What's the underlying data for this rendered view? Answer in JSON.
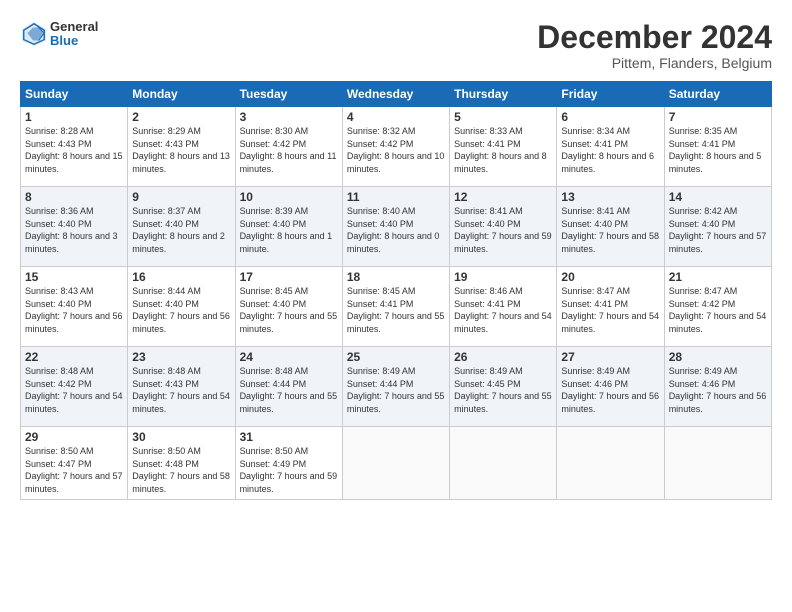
{
  "logo": {
    "general": "General",
    "blue": "Blue"
  },
  "header": {
    "title": "December 2024",
    "subtitle": "Pittem, Flanders, Belgium"
  },
  "days_of_week": [
    "Sunday",
    "Monday",
    "Tuesday",
    "Wednesday",
    "Thursday",
    "Friday",
    "Saturday"
  ],
  "weeks": [
    [
      {
        "day": "1",
        "sunrise": "Sunrise: 8:28 AM",
        "sunset": "Sunset: 4:43 PM",
        "daylight": "Daylight: 8 hours and 15 minutes."
      },
      {
        "day": "2",
        "sunrise": "Sunrise: 8:29 AM",
        "sunset": "Sunset: 4:43 PM",
        "daylight": "Daylight: 8 hours and 13 minutes."
      },
      {
        "day": "3",
        "sunrise": "Sunrise: 8:30 AM",
        "sunset": "Sunset: 4:42 PM",
        "daylight": "Daylight: 8 hours and 11 minutes."
      },
      {
        "day": "4",
        "sunrise": "Sunrise: 8:32 AM",
        "sunset": "Sunset: 4:42 PM",
        "daylight": "Daylight: 8 hours and 10 minutes."
      },
      {
        "day": "5",
        "sunrise": "Sunrise: 8:33 AM",
        "sunset": "Sunset: 4:41 PM",
        "daylight": "Daylight: 8 hours and 8 minutes."
      },
      {
        "day": "6",
        "sunrise": "Sunrise: 8:34 AM",
        "sunset": "Sunset: 4:41 PM",
        "daylight": "Daylight: 8 hours and 6 minutes."
      },
      {
        "day": "7",
        "sunrise": "Sunrise: 8:35 AM",
        "sunset": "Sunset: 4:41 PM",
        "daylight": "Daylight: 8 hours and 5 minutes."
      }
    ],
    [
      {
        "day": "8",
        "sunrise": "Sunrise: 8:36 AM",
        "sunset": "Sunset: 4:40 PM",
        "daylight": "Daylight: 8 hours and 3 minutes."
      },
      {
        "day": "9",
        "sunrise": "Sunrise: 8:37 AM",
        "sunset": "Sunset: 4:40 PM",
        "daylight": "Daylight: 8 hours and 2 minutes."
      },
      {
        "day": "10",
        "sunrise": "Sunrise: 8:39 AM",
        "sunset": "Sunset: 4:40 PM",
        "daylight": "Daylight: 8 hours and 1 minute."
      },
      {
        "day": "11",
        "sunrise": "Sunrise: 8:40 AM",
        "sunset": "Sunset: 4:40 PM",
        "daylight": "Daylight: 8 hours and 0 minutes."
      },
      {
        "day": "12",
        "sunrise": "Sunrise: 8:41 AM",
        "sunset": "Sunset: 4:40 PM",
        "daylight": "Daylight: 7 hours and 59 minutes."
      },
      {
        "day": "13",
        "sunrise": "Sunrise: 8:41 AM",
        "sunset": "Sunset: 4:40 PM",
        "daylight": "Daylight: 7 hours and 58 minutes."
      },
      {
        "day": "14",
        "sunrise": "Sunrise: 8:42 AM",
        "sunset": "Sunset: 4:40 PM",
        "daylight": "Daylight: 7 hours and 57 minutes."
      }
    ],
    [
      {
        "day": "15",
        "sunrise": "Sunrise: 8:43 AM",
        "sunset": "Sunset: 4:40 PM",
        "daylight": "Daylight: 7 hours and 56 minutes."
      },
      {
        "day": "16",
        "sunrise": "Sunrise: 8:44 AM",
        "sunset": "Sunset: 4:40 PM",
        "daylight": "Daylight: 7 hours and 56 minutes."
      },
      {
        "day": "17",
        "sunrise": "Sunrise: 8:45 AM",
        "sunset": "Sunset: 4:40 PM",
        "daylight": "Daylight: 7 hours and 55 minutes."
      },
      {
        "day": "18",
        "sunrise": "Sunrise: 8:45 AM",
        "sunset": "Sunset: 4:41 PM",
        "daylight": "Daylight: 7 hours and 55 minutes."
      },
      {
        "day": "19",
        "sunrise": "Sunrise: 8:46 AM",
        "sunset": "Sunset: 4:41 PM",
        "daylight": "Daylight: 7 hours and 54 minutes."
      },
      {
        "day": "20",
        "sunrise": "Sunrise: 8:47 AM",
        "sunset": "Sunset: 4:41 PM",
        "daylight": "Daylight: 7 hours and 54 minutes."
      },
      {
        "day": "21",
        "sunrise": "Sunrise: 8:47 AM",
        "sunset": "Sunset: 4:42 PM",
        "daylight": "Daylight: 7 hours and 54 minutes."
      }
    ],
    [
      {
        "day": "22",
        "sunrise": "Sunrise: 8:48 AM",
        "sunset": "Sunset: 4:42 PM",
        "daylight": "Daylight: 7 hours and 54 minutes."
      },
      {
        "day": "23",
        "sunrise": "Sunrise: 8:48 AM",
        "sunset": "Sunset: 4:43 PM",
        "daylight": "Daylight: 7 hours and 54 minutes."
      },
      {
        "day": "24",
        "sunrise": "Sunrise: 8:48 AM",
        "sunset": "Sunset: 4:44 PM",
        "daylight": "Daylight: 7 hours and 55 minutes."
      },
      {
        "day": "25",
        "sunrise": "Sunrise: 8:49 AM",
        "sunset": "Sunset: 4:44 PM",
        "daylight": "Daylight: 7 hours and 55 minutes."
      },
      {
        "day": "26",
        "sunrise": "Sunrise: 8:49 AM",
        "sunset": "Sunset: 4:45 PM",
        "daylight": "Daylight: 7 hours and 55 minutes."
      },
      {
        "day": "27",
        "sunrise": "Sunrise: 8:49 AM",
        "sunset": "Sunset: 4:46 PM",
        "daylight": "Daylight: 7 hours and 56 minutes."
      },
      {
        "day": "28",
        "sunrise": "Sunrise: 8:49 AM",
        "sunset": "Sunset: 4:46 PM",
        "daylight": "Daylight: 7 hours and 56 minutes."
      }
    ],
    [
      {
        "day": "29",
        "sunrise": "Sunrise: 8:50 AM",
        "sunset": "Sunset: 4:47 PM",
        "daylight": "Daylight: 7 hours and 57 minutes."
      },
      {
        "day": "30",
        "sunrise": "Sunrise: 8:50 AM",
        "sunset": "Sunset: 4:48 PM",
        "daylight": "Daylight: 7 hours and 58 minutes."
      },
      {
        "day": "31",
        "sunrise": "Sunrise: 8:50 AM",
        "sunset": "Sunset: 4:49 PM",
        "daylight": "Daylight: 7 hours and 59 minutes."
      },
      null,
      null,
      null,
      null
    ]
  ]
}
